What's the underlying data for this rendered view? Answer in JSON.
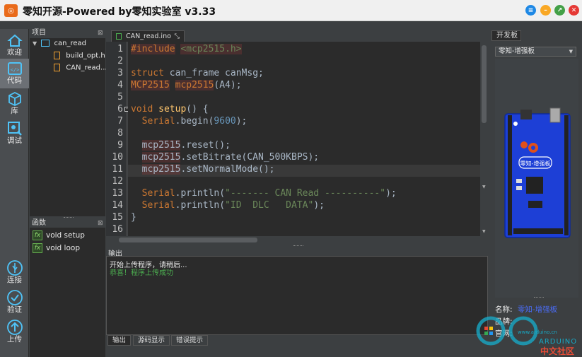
{
  "window": {
    "title": "零知开源-Powered by零知实验室 v3.33",
    "icon": "app-logo-icon"
  },
  "window_controls": [
    {
      "name": "menu",
      "color": "#1e88e5"
    },
    {
      "name": "minimize",
      "color": "#f9a825"
    },
    {
      "name": "maximize",
      "color": "#43a047"
    },
    {
      "name": "close",
      "color": "#e53935"
    }
  ],
  "sidebar": {
    "items": [
      {
        "label": "欢迎",
        "icon": "home-icon"
      },
      {
        "label": "代码",
        "icon": "code-icon"
      },
      {
        "label": "库",
        "icon": "cube-icon"
      },
      {
        "label": "调试",
        "icon": "bug-icon"
      }
    ],
    "bottom": [
      {
        "label": "连接",
        "icon": "usb-icon"
      },
      {
        "label": "验证",
        "icon": "check-icon"
      },
      {
        "label": "上传",
        "icon": "upload-icon"
      }
    ]
  },
  "project": {
    "header": "项目",
    "root": "can_read",
    "files": [
      "build_opt.h",
      "CAN_read..."
    ]
  },
  "functions": {
    "header": "函数",
    "items": [
      "void setup",
      "void loop"
    ]
  },
  "editor": {
    "tab": "CAN_read.ino",
    "line_numbers": [
      "1",
      "2",
      "3",
      "4",
      "5",
      "6",
      "7",
      "8",
      "9",
      "10",
      "11",
      "12",
      "13",
      "14",
      "15",
      "16"
    ],
    "current_line": 11
  },
  "output": {
    "header": "输出",
    "lines": [
      {
        "text": "开始上传程序，请稍后...",
        "color": "#e8e8e8"
      },
      {
        "text": "恭喜！程序上传成功",
        "color": "#4caf50"
      }
    ],
    "tabs": [
      "输出",
      "源码显示",
      "错误提示"
    ]
  },
  "board": {
    "header": "开发板",
    "selected": "零知-增强板",
    "board_label": "零知-增强板",
    "info_labels": [
      "名称:",
      "品牌:",
      "官网:"
    ],
    "name_value": "零知-增强板"
  },
  "watermark": {
    "text1": "ARDUINO",
    "text2": "中文社区",
    "text3": "www.arduino.cn"
  }
}
